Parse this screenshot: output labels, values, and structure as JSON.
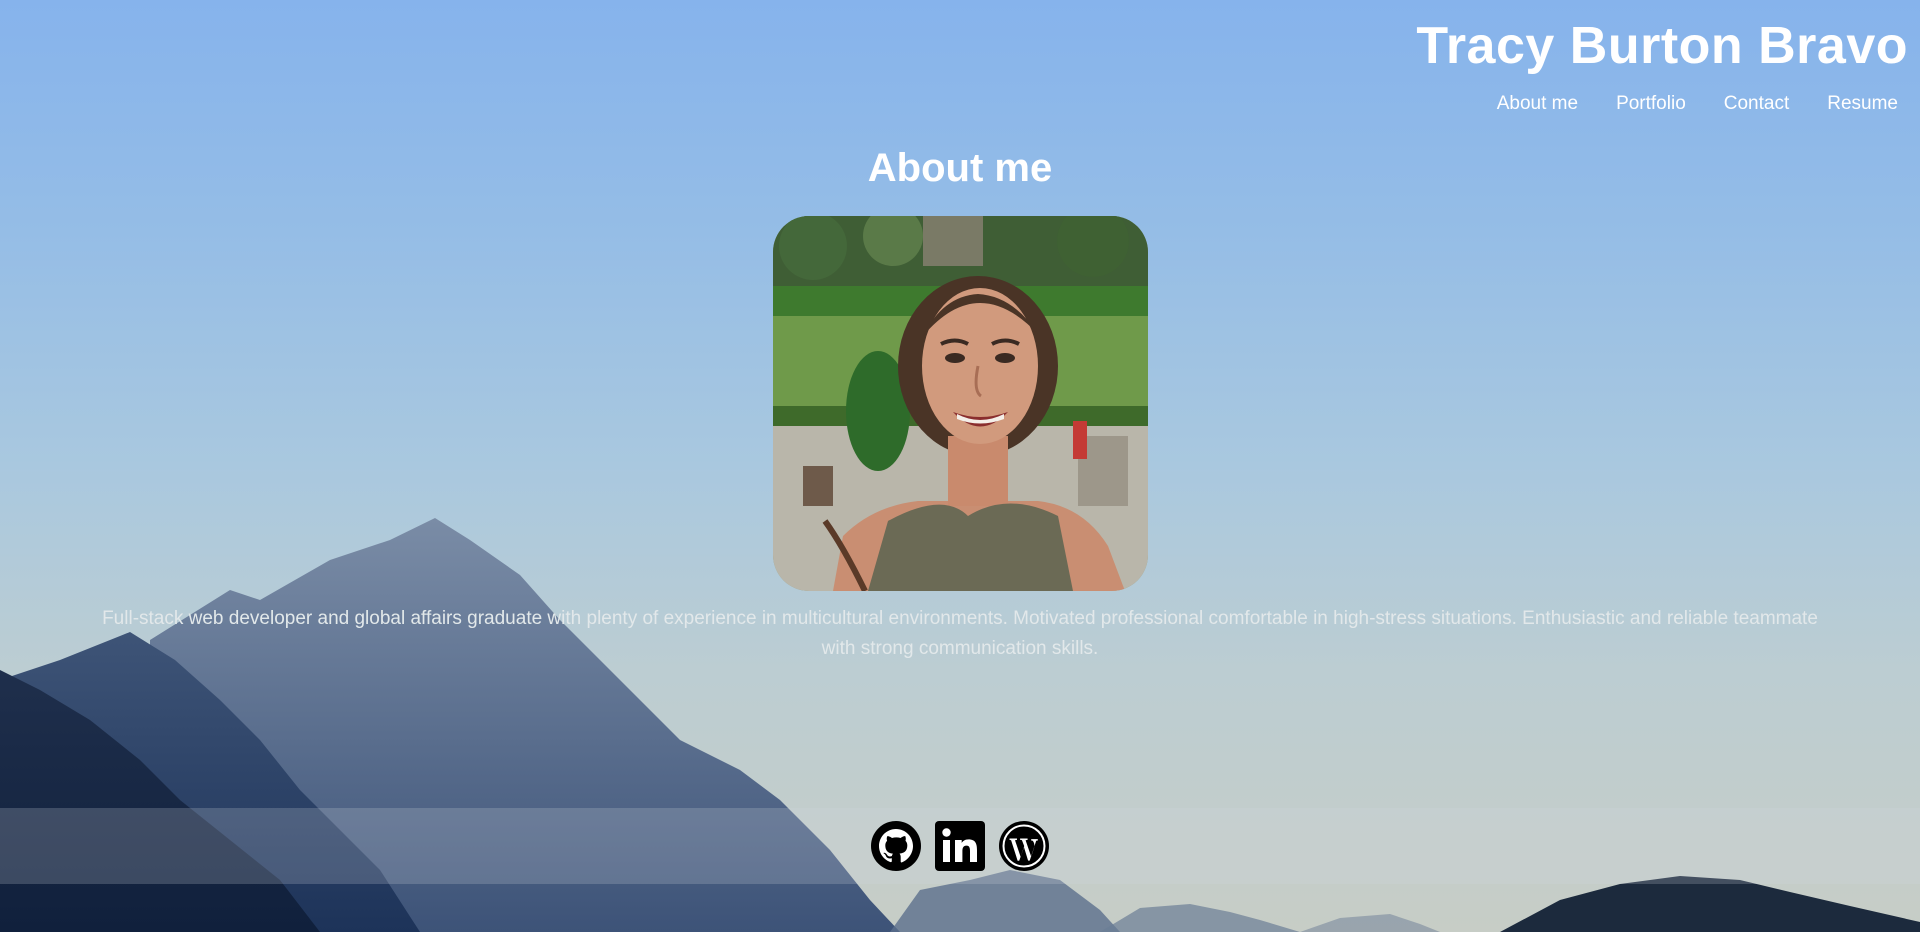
{
  "header": {
    "site_title": "Tracy Burton Bravo",
    "nav": [
      "About me",
      "Portfolio",
      "Contact",
      "Resume"
    ]
  },
  "about": {
    "heading": "About me",
    "bio": "Full-stack web developer and global affairs graduate with plenty of experience in multicultural environments. Motivated professional comfortable in high-stress situations. Enthusiastic and reliable teammate with strong communication skills."
  },
  "social_icons": [
    "github-icon",
    "linkedin-icon",
    "wordpress-icon"
  ]
}
